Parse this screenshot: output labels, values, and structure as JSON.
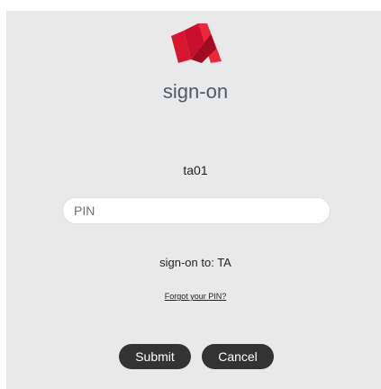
{
  "brand": {
    "logo_icon": "brand-logo-icon",
    "logo_colors": [
      "#c8102e",
      "#e8283f",
      "#a00b22"
    ]
  },
  "header": {
    "title": "sign-on"
  },
  "user": {
    "id": "ta01"
  },
  "pin_field": {
    "placeholder": "PIN",
    "value": ""
  },
  "target": {
    "label": "sign-on to: TA"
  },
  "links": {
    "forgot_pin": "Forgot your PIN?"
  },
  "actions": {
    "submit_label": "Submit",
    "cancel_label": "Cancel",
    "button_color": "#333333"
  },
  "colors": {
    "background": "#e9e9e9",
    "title_text": "#4d5a63"
  }
}
